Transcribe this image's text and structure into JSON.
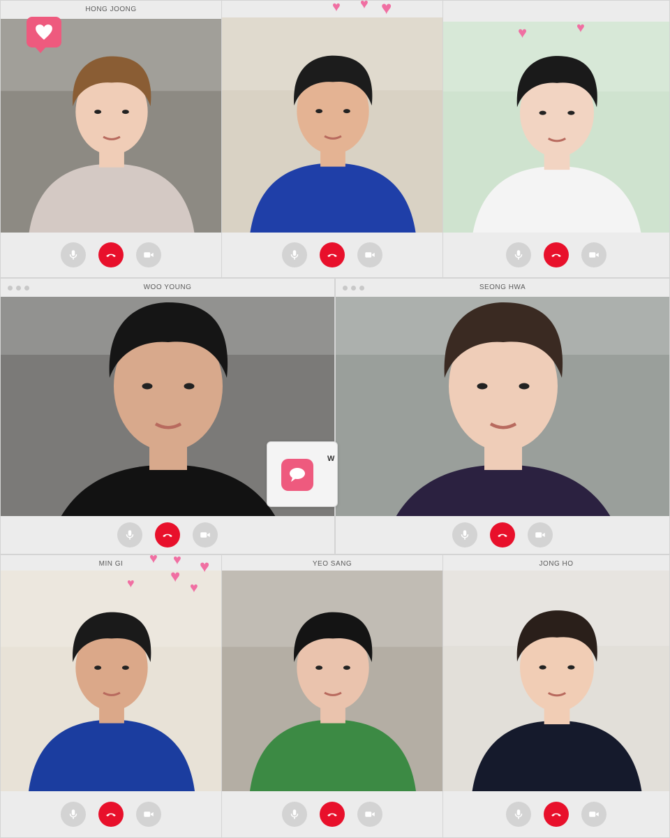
{
  "calls": [
    {
      "title": "HONG JOONG",
      "bg": "#8d8a83",
      "skin": "#f0cdb7",
      "hair": "#8a5d34",
      "top": "#d4c9c4"
    },
    {
      "title": "",
      "bg": "#d9d2c4",
      "skin": "#e4b393",
      "hair": "#1c1c1c",
      "top": "#1f3fa8"
    },
    {
      "title": "",
      "bg": "#cfe3cf",
      "skin": "#f2d4c2",
      "hair": "#1a1a1a",
      "top": "#f4f4f4"
    },
    {
      "title": "WOO YOUNG",
      "bg": "#7b7a78",
      "skin": "#d8a98c",
      "hair": "#151515",
      "top": "#121212"
    },
    {
      "title": "SEONG HWA",
      "bg": "#9a9f9b",
      "skin": "#efcdb8",
      "hair": "#3a2a22",
      "top": "#2b2140"
    },
    {
      "title": "MIN GI",
      "bg": "#e8e2d7",
      "skin": "#dba889",
      "hair": "#1a1a1a",
      "top": "#1b3d9f"
    },
    {
      "title": "YEO SANG",
      "bg": "#b4aea4",
      "skin": "#eac3ad",
      "hair": "#141414",
      "top": "#3c8a44"
    },
    {
      "title": "JONG HO",
      "bg": "#e2dfd9",
      "skin": "#f1cdb5",
      "hair": "#2a1f1a",
      "top": "#151a2c"
    }
  ],
  "message_popup": {
    "text": "W"
  },
  "colors": {
    "end_call": "#e8102b",
    "control_grey": "#d3d3d3",
    "badge_pink": "#ee5a7e"
  },
  "icons": {
    "mute": "microphone-icon",
    "end": "end-call-icon",
    "video": "video-camera-icon",
    "heart": "heart-icon",
    "message": "message-icon"
  }
}
